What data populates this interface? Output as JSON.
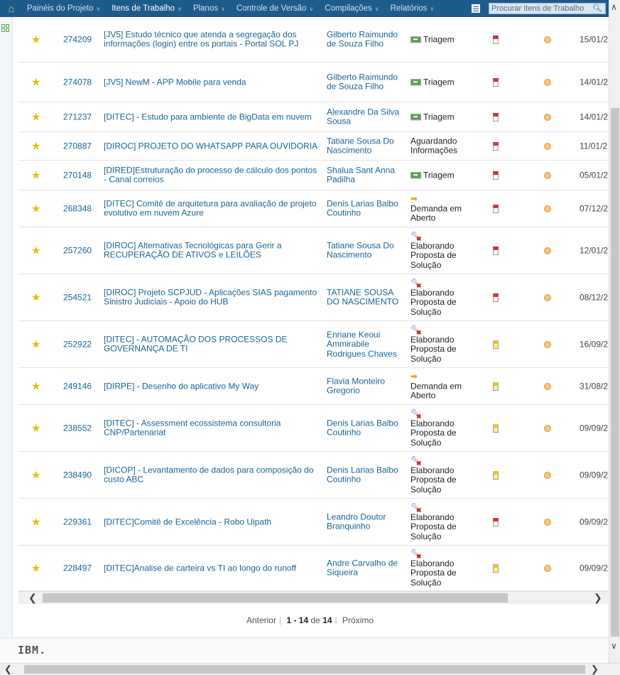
{
  "nav": {
    "items": [
      {
        "label": "Painéis do Projeto",
        "active": false
      },
      {
        "label": "Itens de Trabalho",
        "active": true
      },
      {
        "label": "Planos",
        "active": false
      },
      {
        "label": "Controle de Versão",
        "active": false
      },
      {
        "label": "Compilações",
        "active": false
      },
      {
        "label": "Relatórios",
        "active": false
      }
    ],
    "search_placeholder": "Procurar Itens de Trabalho"
  },
  "rows": [
    {
      "id": "274209",
      "summary": "[JV5] Estudo técnico que atenda a segregação dos informações (login) entre os portais - Portal SOL PJ",
      "owner": "Gilberto Raimundo de Souza Filho",
      "status": "Triagem",
      "status_icon": "triage-icon",
      "priority": "high",
      "date": "15/01/2"
    },
    {
      "id": "274078",
      "summary": "[JV5] NewM - APP Mobile para venda",
      "owner": "Gilberto Raimundo de Souza Filho",
      "status": "Triagem",
      "status_icon": "triage-icon",
      "priority": "high",
      "date": "14/01/2"
    },
    {
      "id": "271237",
      "summary": "[DITEC] - Estudo para ambiente de BigData em nuvem",
      "owner": "Alexandre Da Silva Sousa",
      "status": "Triagem",
      "status_icon": "triage-icon",
      "priority": "high",
      "date": "14/01/2"
    },
    {
      "id": "270887",
      "summary": "[DIROC] PROJETO DO WHATSAPP PARA OUVIDORIA",
      "owner": "Tatiane Sousa Do Nascimento",
      "status": "Aguardando Informações",
      "status_icon": "",
      "priority": "high",
      "date": "11/01/2"
    },
    {
      "id": "270148",
      "summary": "[DIRED]Estruturação do processo de cálculo dos pontos - Canal correios",
      "owner": "Shalua Sant Anna Padilha",
      "status": "Triagem",
      "status_icon": "triage-icon",
      "priority": "high",
      "date": "05/01/2"
    },
    {
      "id": "268348",
      "summary": "[DITEC] Comitê de arquitetura para avaliação de projeto evolutivo em nuvem Azure",
      "owner": "Denis Larias Balbo Coutinho",
      "status": "Demanda em Aberto",
      "status_icon": "arrow-icon",
      "priority": "high",
      "date": "07/12/2"
    },
    {
      "id": "257260",
      "summary": "[DIROC] Alternativas Tecnológicas para Gerir a RECUPERAÇÃO DE ATIVOS e LEILÕES",
      "owner": "Tatiane Sousa Do Nascimento",
      "status": "Elaborando Proposta de Solução",
      "status_icon": "tools-icon",
      "priority": "high",
      "date": "12/01/2"
    },
    {
      "id": "254521",
      "summary": "[DIROC] Projeto SCPJUD - Aplicações SIAS pagamento Sinistro Judiciais - Apoio do HUB",
      "owner": "TATIANE SOUSA DO NASCIMENTO",
      "status": "Elaborando Proposta de Solução",
      "status_icon": "tools-icon",
      "priority": "high",
      "date": "08/12/2"
    },
    {
      "id": "252922",
      "summary": "[DITEC] - AUTOMAÇÃO DOS PROCESSOS DE GOVERNANÇA DE TI",
      "owner": "Enriane Keoui Ammirabile Rodrigues Chaves",
      "status": "Elaborando Proposta de Solução",
      "status_icon": "tools-icon",
      "priority": "med",
      "date": "16/09/2"
    },
    {
      "id": "249146",
      "summary": "[DIRPE] - Desenho do aplicativo My Way",
      "owner": "Flavia Monteiro Gregorio",
      "status": "Demanda em Aberto",
      "status_icon": "arrow-icon",
      "priority": "med",
      "date": "31/08/2"
    },
    {
      "id": "238552",
      "summary": "[DITEC] - Assessment ecossistema consultoria CNP/Partenariat",
      "owner": "Denis Larias Balbo Coutinho",
      "status": "Elaborando Proposta de Solução",
      "status_icon": "tools-icon",
      "priority": "med",
      "date": "09/09/2"
    },
    {
      "id": "238490",
      "summary": "[DICOP] - Levantamento de dados para composição do custo ABC",
      "owner": "Denis Larias Balbo Coutinho",
      "status": "Elaborando Proposta de Solução",
      "status_icon": "tools-icon",
      "priority": "med",
      "date": "09/09/2"
    },
    {
      "id": "229361",
      "summary": "[DITEC]Comitê de Excelência - Robo Uipath",
      "owner": "Leandro Doutor Branquinho",
      "status": "Elaborando Proposta de Solução",
      "status_icon": "tools-icon",
      "priority": "high",
      "date": "09/09/2"
    },
    {
      "id": "228497",
      "summary": "[DITEC]Analise de carteira vs TI ao longo do runoff",
      "owner": "Andre Carvalho de Siqueira",
      "status": "Elaborando Proposta de Solução",
      "status_icon": "tools-icon",
      "priority": "med",
      "date": "09/09/2"
    }
  ],
  "pager": {
    "prev": "Anterior",
    "range": "1 - 14",
    "of": "de",
    "total": "14",
    "next": "Próximo"
  },
  "footer": {
    "logo_text": "IBM."
  }
}
